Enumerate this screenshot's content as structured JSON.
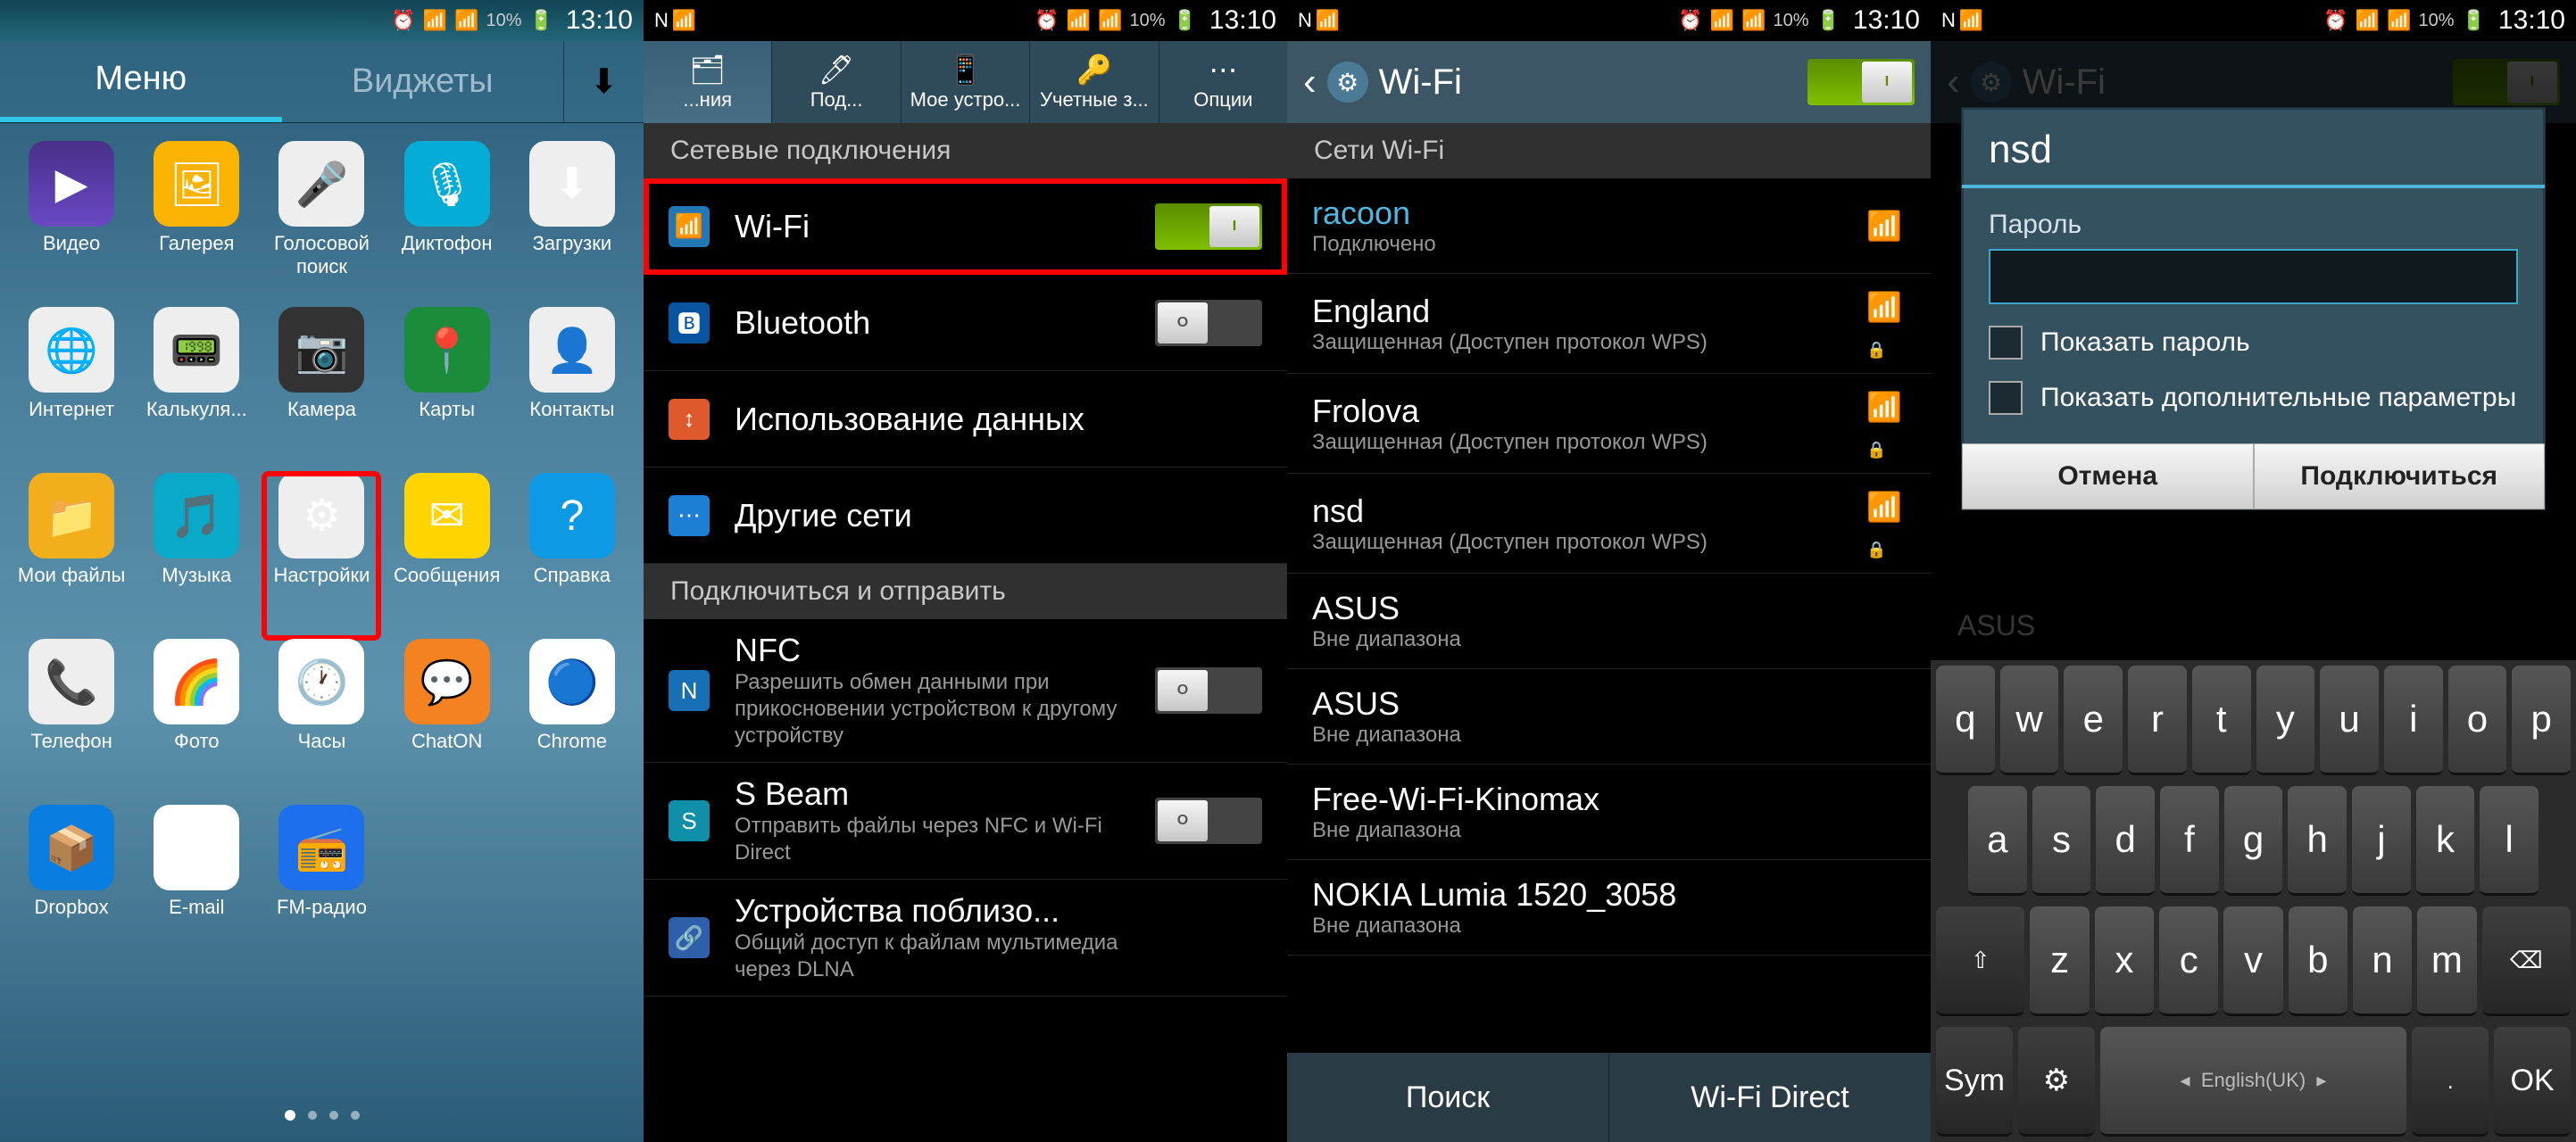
{
  "status": {
    "battery": "10%",
    "time": "13:10"
  },
  "drawer": {
    "tab_menu": "Меню",
    "tab_widgets": "Виджеты",
    "apps": [
      {
        "label": "Видео",
        "name": "app-video",
        "cls": "bg-vid",
        "glyph": "▶"
      },
      {
        "label": "Галерея",
        "name": "app-gallery",
        "cls": "bg-gal",
        "glyph": "🖼"
      },
      {
        "label": "Голосовой поиск",
        "name": "app-voice-search",
        "cls": "bg-vs",
        "glyph": "🎤"
      },
      {
        "label": "Диктофон",
        "name": "app-recorder",
        "cls": "bg-rec",
        "glyph": "🎙"
      },
      {
        "label": "Загрузки",
        "name": "app-downloads",
        "cls": "bg-dl",
        "glyph": "⬇"
      },
      {
        "label": "Интернет",
        "name": "app-internet",
        "cls": "bg-int",
        "glyph": "🌐"
      },
      {
        "label": "Калькуля...",
        "name": "app-calculator",
        "cls": "bg-calc",
        "glyph": "📟"
      },
      {
        "label": "Камера",
        "name": "app-camera",
        "cls": "bg-cam",
        "glyph": "📷"
      },
      {
        "label": "Карты",
        "name": "app-maps",
        "cls": "bg-map",
        "glyph": "📍"
      },
      {
        "label": "Контакты",
        "name": "app-contacts",
        "cls": "bg-con",
        "glyph": "👤"
      },
      {
        "label": "Мои файлы",
        "name": "app-myfiles",
        "cls": "bg-fld",
        "glyph": "📁"
      },
      {
        "label": "Музыка",
        "name": "app-music",
        "cls": "bg-mus",
        "glyph": "🎵"
      },
      {
        "label": "Настройки",
        "name": "app-settings",
        "cls": "bg-set",
        "glyph": "⚙",
        "highlight": true
      },
      {
        "label": "Сообщения",
        "name": "app-messages",
        "cls": "bg-msg",
        "glyph": "✉"
      },
      {
        "label": "Справка",
        "name": "app-help",
        "cls": "bg-hlp",
        "glyph": "?"
      },
      {
        "label": "Телефон",
        "name": "app-phone",
        "cls": "bg-tel",
        "glyph": "📞"
      },
      {
        "label": "Фото",
        "name": "app-photos",
        "cls": "bg-pho",
        "glyph": "🌈"
      },
      {
        "label": "Часы",
        "name": "app-clock",
        "cls": "bg-clk",
        "glyph": "🕐"
      },
      {
        "label": "ChatON",
        "name": "app-chaton",
        "cls": "bg-cht",
        "glyph": "💬"
      },
      {
        "label": "Chrome",
        "name": "app-chrome",
        "cls": "bg-chr",
        "glyph": "🔵"
      },
      {
        "label": "Dropbox",
        "name": "app-dropbox",
        "cls": "bg-dbx",
        "glyph": "📦"
      },
      {
        "label": "E-mail",
        "name": "app-email",
        "cls": "bg-eml",
        "glyph": "✉"
      },
      {
        "label": "FM-радио",
        "name": "app-fmradio",
        "cls": "bg-fm",
        "glyph": "📻"
      }
    ]
  },
  "settings": {
    "tabs": [
      {
        "label": "...ния",
        "name": "tab-connections",
        "glyph": "🗂",
        "active": true
      },
      {
        "label": "Под...",
        "name": "tab-sub",
        "glyph": "🖊"
      },
      {
        "label": "Мое устро...",
        "name": "tab-mydevice",
        "glyph": "📱"
      },
      {
        "label": "Учетные з...",
        "name": "tab-accounts",
        "glyph": "🔑"
      },
      {
        "label": "Опции",
        "name": "tab-options",
        "glyph": "⋯"
      }
    ],
    "section_network": "Сетевые подключения",
    "section_share": "Подключиться и отправить",
    "rows": {
      "wifi": {
        "title": "Wi-Fi",
        "icon": "ric-wifi",
        "glyph": "📶",
        "toggle": "on",
        "highlight": true
      },
      "bluetooth": {
        "title": "Bluetooth",
        "icon": "ric-bt",
        "glyph": "🅱",
        "toggle": "off"
      },
      "data": {
        "title": "Использование данных",
        "icon": "ric-data",
        "glyph": "↕"
      },
      "more": {
        "title": "Другие сети",
        "icon": "ric-net",
        "glyph": "⋯"
      },
      "nfc": {
        "title": "NFC",
        "sub": "Разрешить обмен данными при прикосновении устройством к другому устройству",
        "icon": "ric-nfc",
        "glyph": "N",
        "toggle": "off"
      },
      "sbeam": {
        "title": "S Beam",
        "sub": "Отправить файлы через NFC и Wi-Fi Direct",
        "icon": "ric-sb",
        "glyph": "S",
        "toggle": "off"
      },
      "nearby": {
        "title": "Устройства поблизо...",
        "sub": "Общий доступ к файлам мультимедиа через DLNA",
        "icon": "ric-nb",
        "glyph": "🔗"
      }
    }
  },
  "wifi": {
    "title": "Wi-Fi",
    "section": "Сети Wi-Fi",
    "networks": [
      {
        "name": "racoon",
        "status": "Подключено",
        "connected": true,
        "lock": false
      },
      {
        "name": "England",
        "status": "Защищенная (Доступен протокол WPS)",
        "lock": true
      },
      {
        "name": "Frolova",
        "status": "Защищенная (Доступен протокол WPS)",
        "lock": true
      },
      {
        "name": "nsd",
        "status": "Защищенная (Доступен протокол WPS)",
        "lock": true
      },
      {
        "name": "ASUS",
        "status": "Вне диапазона",
        "lock": false,
        "nosig": true
      },
      {
        "name": "ASUS",
        "status": "Вне диапазона",
        "lock": false,
        "nosig": true
      },
      {
        "name": "Free-Wi-Fi-Kinomax",
        "status": "Вне диапазона",
        "lock": false,
        "nosig": true
      },
      {
        "name": "NOKIA Lumia 1520_3058",
        "status": "Вне диапазона",
        "lock": false,
        "nosig": true
      }
    ],
    "btn_scan": "Поиск",
    "btn_direct": "Wi-Fi Direct"
  },
  "dialog": {
    "wifi_title": "Wi-Fi",
    "title": "nsd",
    "password_label": "Пароль",
    "show_password": "Показать пароль",
    "show_advanced": "Показать дополнительные параметры",
    "cancel": "Отмена",
    "connect": "Подключиться",
    "bg_asus": "ASUS"
  },
  "keyboard": {
    "row1": [
      "q",
      "w",
      "e",
      "r",
      "t",
      "y",
      "u",
      "i",
      "o",
      "p"
    ],
    "row2": [
      "a",
      "s",
      "d",
      "f",
      "g",
      "h",
      "j",
      "k",
      "l"
    ],
    "row3": [
      "z",
      "x",
      "c",
      "v",
      "b",
      "n",
      "m"
    ],
    "shift": "⇧",
    "backspace": "⌫",
    "sym": "Sym",
    "settings": "⚙",
    "space": "English(UK)",
    "dot": ".",
    "ok": "OK"
  }
}
